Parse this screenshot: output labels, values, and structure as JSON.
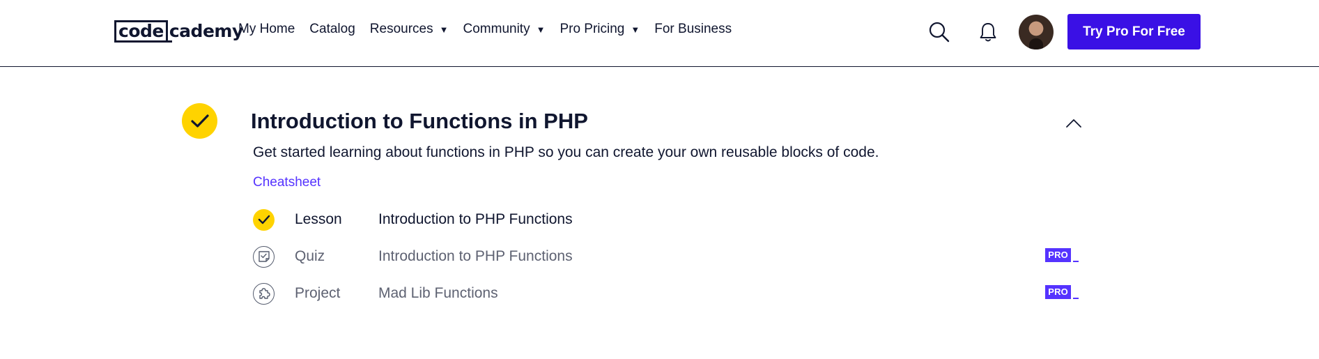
{
  "header": {
    "logo": {
      "boxed": "code",
      "rest": "cademy"
    },
    "nav": [
      {
        "label": "My Home",
        "dropdown": false
      },
      {
        "label": "Catalog",
        "dropdown": false
      },
      {
        "label": "Resources",
        "dropdown": true
      },
      {
        "label": "Community",
        "dropdown": true
      },
      {
        "label": "Pro Pricing",
        "dropdown": true
      },
      {
        "label": "For Business",
        "dropdown": false
      }
    ],
    "caret": "▼",
    "icons": {
      "search": "search-icon",
      "notifications": "bell-icon"
    },
    "cta_label": "Try Pro For Free"
  },
  "module": {
    "status": "completed",
    "title": "Introduction to Functions in PHP",
    "description": "Get started learning about functions in PHP so you can create your own reusable blocks of code.",
    "cheatsheet_label": "Cheatsheet",
    "items": [
      {
        "type": "Lesson",
        "name": "Introduction to PHP Functions",
        "completed": true,
        "pro": false
      },
      {
        "type": "Quiz",
        "name": "Introduction to PHP Functions",
        "completed": false,
        "pro": true
      },
      {
        "type": "Project",
        "name": "Mad Lib Functions",
        "completed": false,
        "pro": true
      }
    ],
    "pro_label": "PRO"
  },
  "colors": {
    "brand_navy": "#10162f",
    "cta_purple": "#3a10e5",
    "link_purple": "#5533ff",
    "complete_yellow": "#ffd300",
    "muted_text": "#5e6272"
  }
}
